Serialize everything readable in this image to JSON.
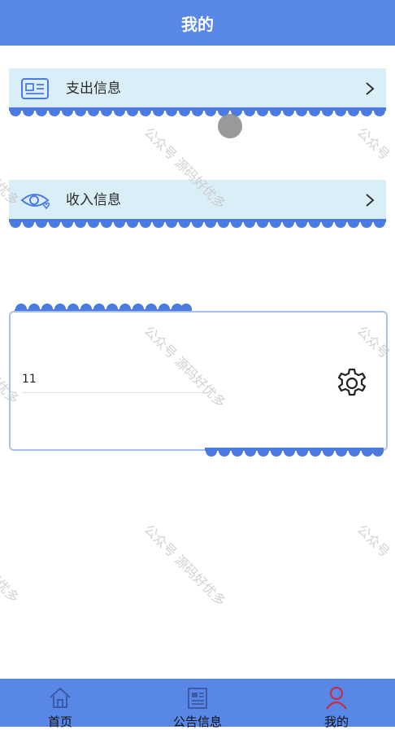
{
  "header": {
    "title": "我的"
  },
  "menu": [
    {
      "label": "支出信息",
      "icon": "id-card-icon"
    },
    {
      "label": "收入信息",
      "icon": "eye-heart-icon"
    }
  ],
  "user_card": {
    "name": "11",
    "settings_icon": "gear-icon"
  },
  "watermark": {
    "text_a": "公众号 源码好优多",
    "text_b": "公众号",
    "text_c": "好优多"
  },
  "tabbar": {
    "tabs": [
      {
        "label": "首页",
        "icon": "home-icon"
      },
      {
        "label": "公告信息",
        "icon": "notice-icon"
      },
      {
        "label": "我的",
        "icon": "user-icon"
      }
    ]
  },
  "colors": {
    "primary": "#5887e6",
    "card_bg": "#d9eef6",
    "scallop": "#4b7be0",
    "active_tab": "#c0304a"
  }
}
